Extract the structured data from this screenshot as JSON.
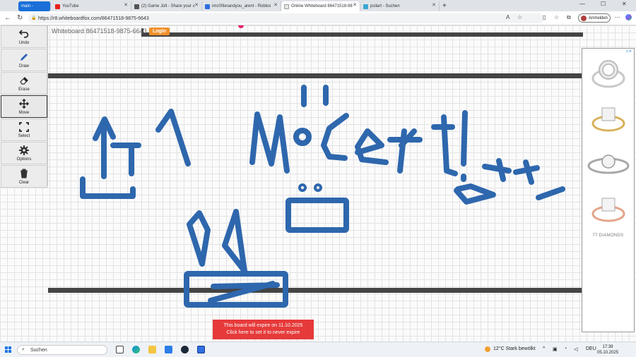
{
  "browser": {
    "tabs": [
      {
        "label": "main -",
        "active": false
      },
      {
        "label": "YouTube",
        "active": false
      },
      {
        "label": "(2) Game Jolt - Share your c",
        "active": false
      },
      {
        "label": "imc00lerandyou_arent - Roblox",
        "active": false
      },
      {
        "label": "Online Whiteboard 86471518-98",
        "active": true
      },
      {
        "label": "psilart - Suchen",
        "active": false
      }
    ],
    "url": "https://r8.whiteboardfox.com/86471518-9875-6643",
    "signin_label": "Anmelden"
  },
  "whiteboard": {
    "title": "Whiteboard 86471518-9875-6643",
    "login_label": "Login",
    "tools": [
      {
        "label": "Undo",
        "icon": "undo-icon",
        "active": false
      },
      {
        "label": "Draw",
        "icon": "pencil-icon",
        "active": false
      },
      {
        "label": "Erase",
        "icon": "eraser-icon",
        "active": false
      },
      {
        "label": "Move",
        "icon": "move-icon",
        "active": true
      },
      {
        "label": "Select",
        "icon": "select-icon",
        "active": false
      },
      {
        "label": "Options",
        "icon": "gear-icon",
        "active": false
      },
      {
        "label": "Clear",
        "icon": "trash-icon",
        "active": false
      }
    ],
    "expiry_line1": "This board will expire on 11.10.2025",
    "expiry_line2": "Click here to set it to never expire",
    "stroke_color": "#2e67ad"
  },
  "ad": {
    "brand": "77 DIAMONDS"
  },
  "taskbar": {
    "search_label": "Suchen",
    "weather": "12°C  Stark bewölkt",
    "language": "DEU",
    "time": "17:39",
    "date": "05.10.2025"
  }
}
